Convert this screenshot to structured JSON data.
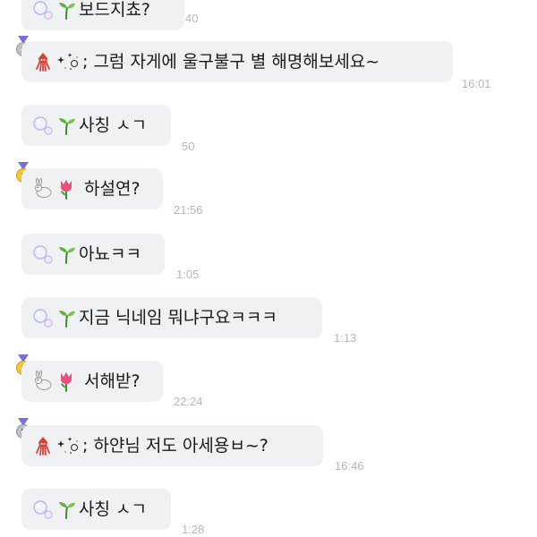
{
  "messages": [
    {
      "text": "보드지쵸?",
      "time": "40"
    },
    {
      "text": "; 그럼 자게에 울구불구 별 해명해보세요~",
      "time": "16:01"
    },
    {
      "text": "사칭 ㅅㄱ",
      "time": "50"
    },
    {
      "text": "하설연?",
      "time": "21:56"
    },
    {
      "text": "아뇨ㅋㅋ",
      "time": "1:05"
    },
    {
      "text": "지금 닉네임 뭐냐구요ㅋㅋㅋ",
      "time": "1:13"
    },
    {
      "text": "서해받?",
      "time": "22:24"
    },
    {
      "text": "; 하얀님 저도 아세용ㅂ~?",
      "time": "16:46"
    },
    {
      "text": "사칭 ㅅㄱ",
      "time": "1:28"
    }
  ],
  "icons": {
    "medal_silver": "silver-medal-icon",
    "medal_gold": "gold-medal-icon",
    "bubbles": "bubbles-icon",
    "seedling": "seedling-icon",
    "squid": "squid-icon",
    "sparkles": "sparkle-icon",
    "rabbit": "rabbit-icon",
    "tulip": "tulip-icon"
  },
  "colors": {
    "bubble": "#f0f1f3",
    "timestamp": "#b4b7bc",
    "text": "#1a1a1a"
  }
}
